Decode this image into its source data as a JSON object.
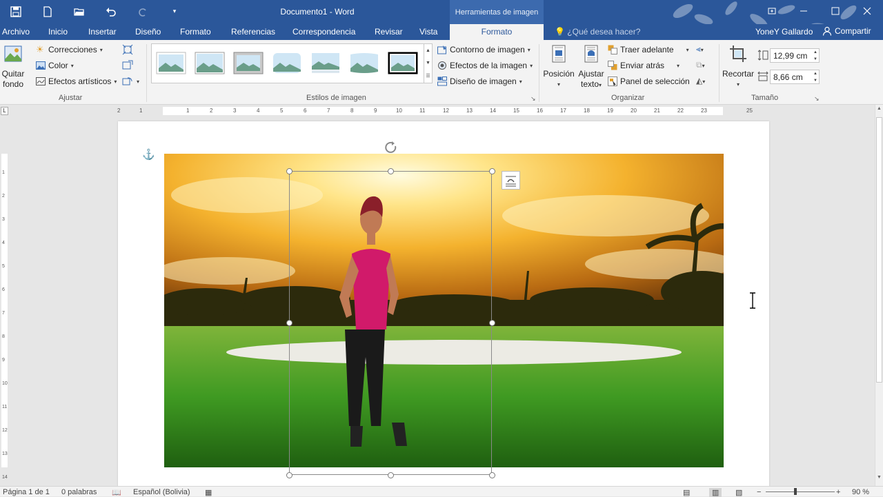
{
  "window": {
    "title": "Documento1 - Word",
    "contextual_tab_header": "Herramientas de imagen",
    "controls": [
      "restore-ribbon-icon",
      "minimize-icon",
      "maximize-icon",
      "close-icon"
    ]
  },
  "quick_access": [
    "save-icon",
    "new-document-icon",
    "open-folder-icon",
    "undo-icon",
    "redo-icon",
    "customize-qat-icon"
  ],
  "tabs": [
    {
      "label": "Archivo"
    },
    {
      "label": "Inicio"
    },
    {
      "label": "Insertar"
    },
    {
      "label": "Diseño"
    },
    {
      "label": "Formato"
    },
    {
      "label": "Referencias"
    },
    {
      "label": "Correspondencia"
    },
    {
      "label": "Revisar"
    },
    {
      "label": "Vista"
    },
    {
      "label": "Formato"
    }
  ],
  "tell_me": "¿Qué desea hacer?",
  "user": "YoneY Gallardo",
  "share": "Compartir",
  "ribbon": {
    "ajustar": {
      "label": "Ajustar",
      "quitar_fondo_1": "Quitar",
      "quitar_fondo_2": "fondo",
      "correcciones": "Correcciones",
      "color": "Color",
      "efectos_artisticos": "Efectos artísticos"
    },
    "estilos": {
      "label": "Estilos de imagen",
      "contorno": "Contorno de imagen",
      "efectos": "Efectos de la imagen",
      "diseno": "Diseño de imagen"
    },
    "organizar": {
      "label": "Organizar",
      "posicion": "Posición",
      "ajustar_texto_1": "Ajustar",
      "ajustar_texto_2": "texto",
      "traer_adelante": "Traer adelante",
      "enviar_atras": "Enviar atrás",
      "panel_seleccion": "Panel de selección"
    },
    "tamano": {
      "label": "Tamaño",
      "recortar": "Recortar",
      "alto": "12,99 cm",
      "ancho": "8,66 cm"
    }
  },
  "ruler_numbers": [
    "2",
    "1",
    "1",
    "2",
    "3",
    "4",
    "5",
    "6",
    "7",
    "8",
    "9",
    "10",
    "11",
    "12",
    "13",
    "14",
    "15",
    "16",
    "17",
    "18",
    "19",
    "20",
    "21",
    "22",
    "23",
    "25"
  ],
  "vruler_numbers": [
    "1",
    "2",
    "3",
    "4",
    "5",
    "6",
    "7",
    "8",
    "9",
    "10",
    "11",
    "12",
    "13",
    "14"
  ],
  "status": {
    "page": "Página 1 de 1",
    "words": "0 palabras",
    "language": "Español (Bolivia)",
    "zoom": "90 %"
  }
}
